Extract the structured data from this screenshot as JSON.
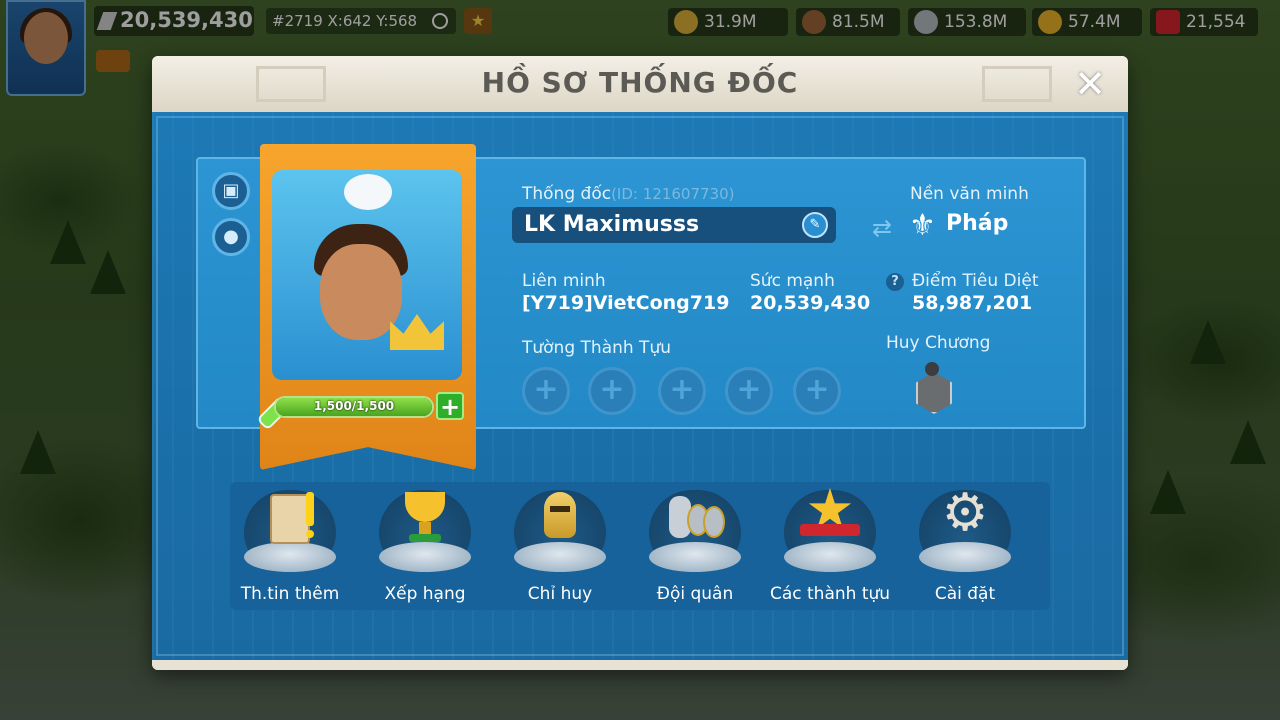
{
  "hud": {
    "power": "20,539,430",
    "coords": "#2719 X:642 Y:568",
    "resources": [
      {
        "name": "food",
        "value": "31.9M",
        "color": "#e0b43a"
      },
      {
        "name": "wood",
        "value": "81.5M",
        "color": "#a0683a"
      },
      {
        "name": "stone",
        "value": "153.8M",
        "color": "#b9c0c6"
      },
      {
        "name": "gold",
        "value": "57.4M",
        "color": "#f0b62a"
      },
      {
        "name": "gems",
        "value": "21,554",
        "color": "#d8262e"
      }
    ]
  },
  "dialog": {
    "title": "HỒ SƠ THỐNG ĐỐC",
    "close": "✕"
  },
  "profile": {
    "governor_label": "Thống đốc",
    "id_text": "(ID: 121607730)",
    "name": "LK Maximusss",
    "civilization_label": "Nền văn minh",
    "civilization": "Pháp",
    "alliance_label": "Liên minh",
    "alliance": "[Y719]VietCong719",
    "power_label": "Sức mạnh",
    "power": "20,539,430",
    "kills_label": "Điểm Tiêu Diệt",
    "kills": "58,987,201",
    "wall_label": "Tường Thành Tựu",
    "medal_label": "Huy Chương",
    "stamina": "1,500/1,500",
    "stamina_fraction": 1.0,
    "plus": "+",
    "slot_plus": "+"
  },
  "menu": [
    {
      "label": "Th.tin thêm",
      "icon": "scroll-icon"
    },
    {
      "label": "Xếp hạng",
      "icon": "trophy-icon"
    },
    {
      "label": "Chỉ huy",
      "icon": "helmet-icon"
    },
    {
      "label": "Đội quân",
      "icon": "soldiers-icon"
    },
    {
      "label": "Các thành tựu",
      "icon": "star-banner-icon"
    },
    {
      "label": "Cài đặt",
      "icon": "gear-icon"
    }
  ]
}
